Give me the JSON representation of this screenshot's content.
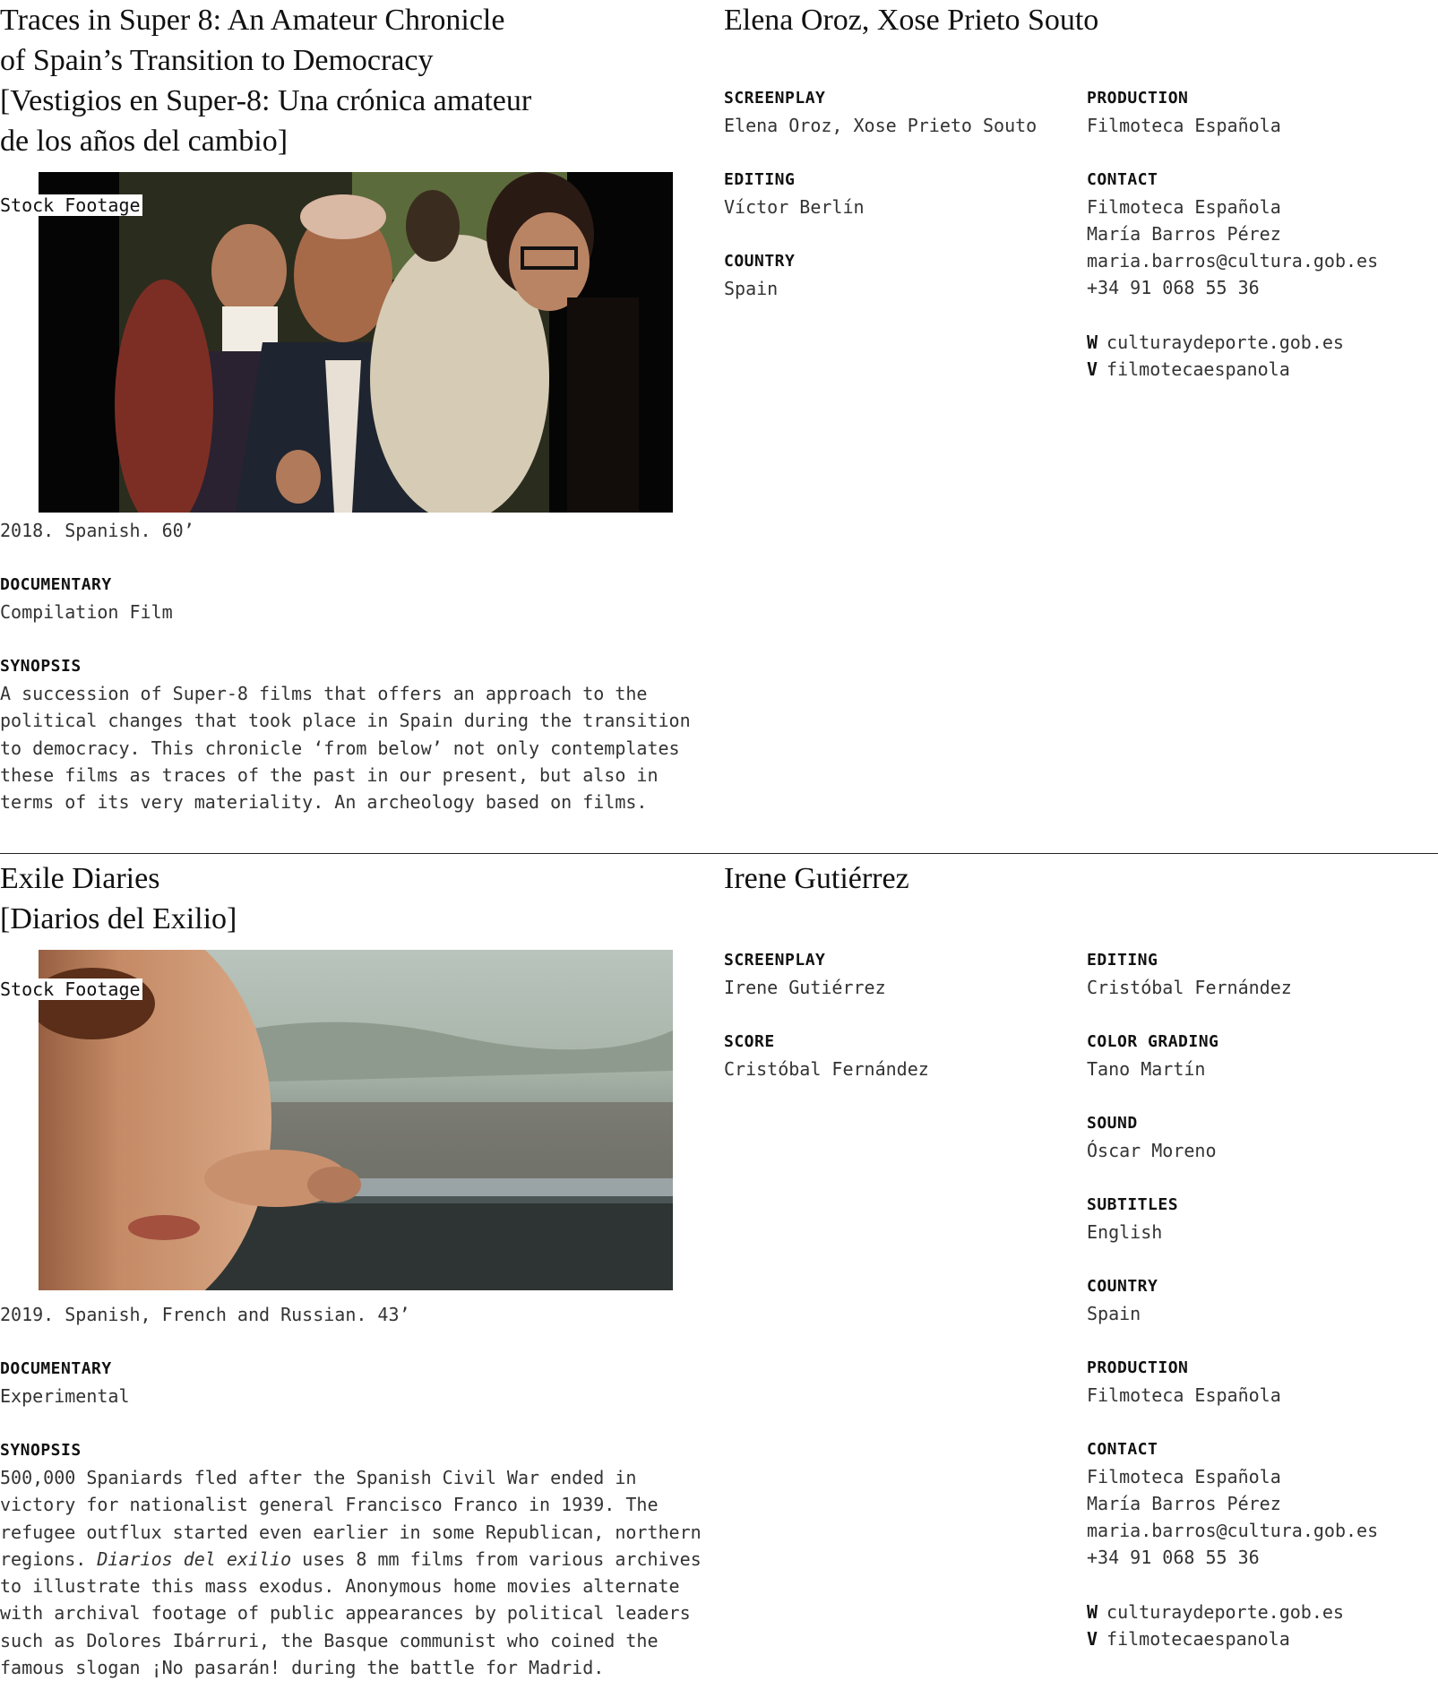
{
  "entries": [
    {
      "title_lines": [
        "Traces in Super 8: An Amateur Chronicle",
        "of Spain’s Transition to Democracy",
        "[Vestigios en Super-8: Una crónica amateur",
        "de los años del cambio]"
      ],
      "director": "Elena Oroz, Xose Prieto Souto",
      "still_tag": "Stock Footage",
      "year_line": "2018. Spanish. 60’",
      "genre_label": "DOCUMENTARY",
      "genre_value": "Compilation Film",
      "synopsis_label": "SYNOPSIS",
      "synopsis": "A succession of Super-8 films that offers an approach to the political changes that took place in Spain during the transition to democracy. This chronicle ‘from below’ not only contemplates these films as traces of the past in our present, but also in terms of its very materiality. An archeology based on films.",
      "credits_left": [
        {
          "label": "SCREENPLAY",
          "value": "Elena Oroz, Xose Prieto Souto"
        },
        {
          "label": "EDITING",
          "value": "Víctor Berlín"
        },
        {
          "label": "COUNTRY",
          "value": "Spain"
        }
      ],
      "credits_right": [
        {
          "label": "PRODUCTION",
          "value": "Filmoteca Española"
        },
        {
          "label": "CONTACT",
          "value": "Filmoteca Española\nMaría Barros Pérez\nmaria.barros@cultura.gob.es\n+34 91 068 55 36"
        }
      ],
      "links": [
        {
          "key": "W",
          "value": "culturaydeporte.gob.es"
        },
        {
          "key": "V",
          "value": "filmotecaespanola"
        }
      ]
    },
    {
      "title_lines": [
        "Exile Diaries",
        "[Diarios del Exilio]"
      ],
      "director": "Irene Gutiérrez",
      "still_tag": "Stock Footage",
      "year_line": "2019. Spanish, French and Russian. 43’",
      "genre_label": "DOCUMENTARY",
      "genre_value": "Experimental",
      "synopsis_label": "SYNOPSIS",
      "synopsis_a": "500,000 Spaniards fled after the Spanish Civil War ended in victory for nationalist general Francisco Franco in 1939. The refugee outflux started even earlier in some Republican, northern regions. ",
      "synopsis_italic": "Diarios del exilio",
      "synopsis_b": " uses 8 mm films from various archives to illustrate this mass exodus. Anonymous home movies alternate with archival footage of public appearances by political leaders such as Dolores Ibárruri, the Basque communist who coined the famous slogan ¡No pasarán! during the battle for Madrid.",
      "credits_left": [
        {
          "label": "SCREENPLAY",
          "value": "Irene Gutiérrez"
        },
        {
          "label": "SCORE",
          "value": "Cristóbal Fernández"
        }
      ],
      "credits_right": [
        {
          "label": "EDITING",
          "value": "Cristóbal Fernández"
        },
        {
          "label": "COLOR GRADING",
          "value": "Tano Martín"
        },
        {
          "label": "SOUND",
          "value": "Óscar Moreno"
        },
        {
          "label": "SUBTITLES",
          "value": "English"
        },
        {
          "label": "COUNTRY",
          "value": "Spain"
        },
        {
          "label": "PRODUCTION",
          "value": "Filmoteca Española"
        },
        {
          "label": "CONTACT",
          "value": "Filmoteca Española\nMaría Barros Pérez\nmaria.barros@cultura.gob.es\n+34 91 068 55 36"
        }
      ],
      "links": [
        {
          "key": "W",
          "value": "culturaydeporte.gob.es"
        },
        {
          "key": "V",
          "value": "filmotecaespanola"
        }
      ]
    }
  ]
}
